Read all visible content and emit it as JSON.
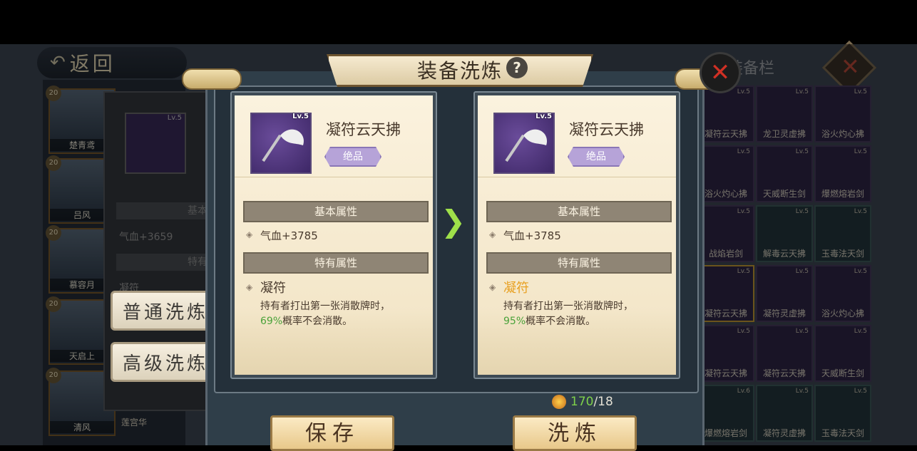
{
  "background": {
    "back_label": "返回",
    "equip_tab": "装备栏",
    "heroes": [
      {
        "name": "楚青鸢",
        "level": "20"
      },
      {
        "name": "吕风",
        "level": "20"
      },
      {
        "name": "慕容月",
        "level": "20"
      },
      {
        "name": "天启上",
        "level": "20"
      },
      {
        "name": "清风",
        "level": "20"
      }
    ],
    "hero_extra": "莲宫华",
    "detail": {
      "level": "Lv.5",
      "section_basic": "基本",
      "attr": "气血+3659",
      "section_special": "特有",
      "skill": "凝符"
    },
    "buttons": {
      "normal": "普通洗炼",
      "advanced": "高级洗炼"
    },
    "grid": [
      {
        "name": "凝符云天拂",
        "lv": "Lv.5",
        "kind": "purple"
      },
      {
        "name": "龙卫灵虚拂",
        "lv": "Lv.5",
        "kind": "purple"
      },
      {
        "name": "浴火灼心拂",
        "lv": "Lv.5",
        "kind": "purple"
      },
      {
        "name": "浴火灼心拂",
        "lv": "Lv.5",
        "kind": "purple"
      },
      {
        "name": "天威断生剑",
        "lv": "Lv.5",
        "kind": "purple"
      },
      {
        "name": "爆燃熔岩剑",
        "lv": "Lv.5",
        "kind": "purple"
      },
      {
        "name": "战焰岩剑",
        "lv": "Lv.5",
        "kind": "purple"
      },
      {
        "name": "解毒云天拂",
        "lv": "Lv.5",
        "kind": "green"
      },
      {
        "name": "玉毒法天剑",
        "lv": "Lv.5",
        "kind": "green"
      },
      {
        "name": "凝符云天拂",
        "lv": "Lv.5",
        "kind": "purple",
        "selected": true
      },
      {
        "name": "凝符灵虚拂",
        "lv": "Lv.5",
        "kind": "purple"
      },
      {
        "name": "浴火灼心拂",
        "lv": "Lv.5",
        "kind": "purple"
      },
      {
        "name": "凝符云天拂",
        "lv": "Lv.5",
        "kind": "purple"
      },
      {
        "name": "凝符云天拂",
        "lv": "Lv.5",
        "kind": "purple"
      },
      {
        "name": "天威断生剑",
        "lv": "Lv.5",
        "kind": "purple"
      },
      {
        "name": "爆燃熔岩剑",
        "lv": "Lv.6",
        "kind": "green"
      },
      {
        "name": "凝符灵虚拂",
        "lv": "Lv.5",
        "kind": "green"
      },
      {
        "name": "玉毒法天剑",
        "lv": "Lv.5",
        "kind": "green"
      }
    ]
  },
  "modal": {
    "title": "装备洗炼",
    "help_icon": "?",
    "close_icon": "✕",
    "cards": {
      "before": {
        "level": "Lv.5",
        "name": "凝符云天拂",
        "quality": "绝品",
        "basic_header": "基本属性",
        "basic_attr": "气血+3785",
        "special_header": "特有属性",
        "skill_name": "凝符",
        "desc_line1": "持有者打出第一张消散牌时，",
        "desc_pct": "69%",
        "desc_line2": "概率不会消散。"
      },
      "after": {
        "level": "Lv.5",
        "name": "凝符云天拂",
        "quality": "绝品",
        "basic_header": "基本属性",
        "basic_attr": "气血+3785",
        "special_header": "特有属性",
        "skill_name": "凝符",
        "desc_line1": "持有者打出第一张消散牌时，",
        "desc_pct": "95%",
        "desc_line2": "概率不会消散。"
      }
    },
    "cost": {
      "have": "170",
      "need": "/18"
    },
    "save_label": "保存",
    "refine_label": "洗炼"
  },
  "colors": {
    "accent_green": "#7ed04a",
    "highlight_orange": "#e8a020",
    "quality_purple": "#b6a3d8"
  }
}
